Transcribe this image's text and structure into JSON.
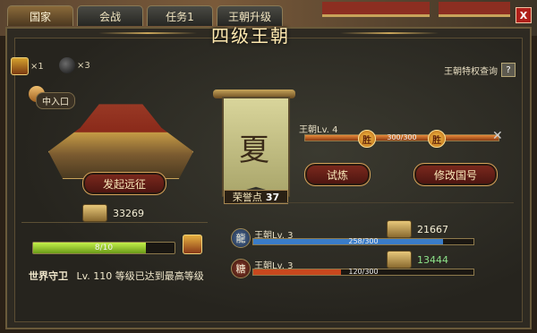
{
  "tabs": [
    {
      "label": "国家",
      "active": true
    },
    {
      "label": "会战",
      "active": false
    },
    {
      "label": "任务1",
      "active": false
    },
    {
      "label": "王朝升级",
      "active": false
    }
  ],
  "close_label": "X",
  "title": "四级王朝",
  "privilege_query": {
    "label": "王朝特权查询",
    "button": "?"
  },
  "items": [
    {
      "icon": "treasure-box-icon",
      "count": "×1"
    },
    {
      "icon": "bomb-icon",
      "count": "×3"
    }
  ],
  "entry": {
    "label": "中入口"
  },
  "expedition_button": "发起远征",
  "left_resource": {
    "value": "33269"
  },
  "left_progress": {
    "text": "8/10",
    "fraction": 0.8
  },
  "guard": {
    "name": "世界守卫",
    "level": "Lv. 110",
    "status": "等级已达到最高等级"
  },
  "banner": {
    "character": "夏",
    "achievement_label": "荣誉点",
    "achievement_value": "37"
  },
  "dynasty_main": {
    "label": "王朝Lv. 4",
    "bar_text": "300/300",
    "fraction": 1.0,
    "win_marker": "胜"
  },
  "trial_button": "试炼",
  "modify_button": "修改国号",
  "rivals": [
    {
      "badge": "龍",
      "badge_color": "#2e4a78",
      "label": "王朝Lv. 3",
      "bar_text": "258/300",
      "fraction": 0.86,
      "bar_color": "#3a7cc8",
      "resource": "21667",
      "resource_color": "#f5efd6"
    },
    {
      "badge": "糖",
      "badge_color": "#6a2a1e",
      "label": "王朝Lv. 3",
      "bar_text": "120/300",
      "fraction": 0.4,
      "bar_color": "#c8481e",
      "resource": "13444",
      "resource_color": "#8de28a"
    }
  ],
  "colors": {
    "accent_gold": "#c8a35a",
    "panel_bg": "#2e2a22",
    "button_red": "#7e2a1e"
  }
}
